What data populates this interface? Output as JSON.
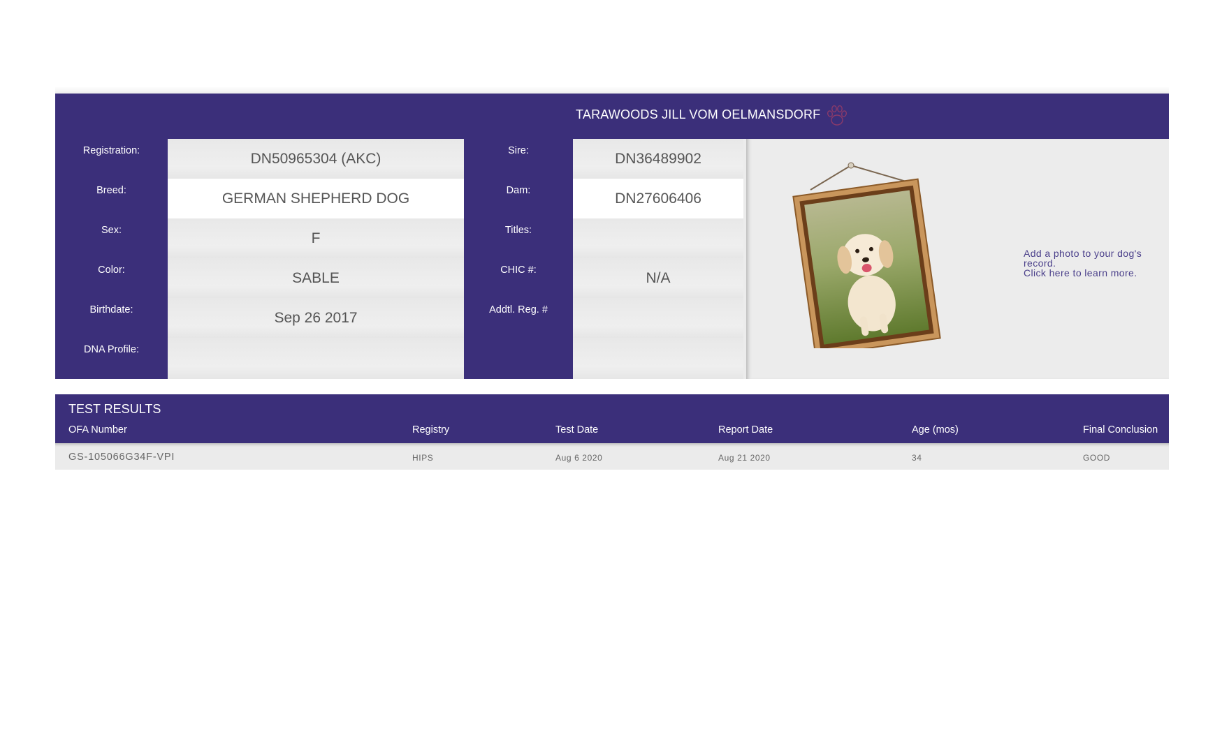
{
  "dog": {
    "name": "TARAWOODS JILL VOM OELMANSDORF"
  },
  "labels_left": {
    "registration": "Registration:",
    "breed": "Breed:",
    "sex": "Sex:",
    "color": "Color:",
    "birthdate": "Birthdate:",
    "dna_profile": "DNA Profile:"
  },
  "values_left": {
    "registration": "DN50965304 (AKC)",
    "breed": "GERMAN SHEPHERD DOG",
    "sex": "F",
    "color": "SABLE",
    "birthdate": "Sep 26 2017",
    "dna_profile": ""
  },
  "labels_right": {
    "sire": "Sire:",
    "dam": "Dam:",
    "titles": "Titles:",
    "chic": "CHIC #:",
    "addtl_reg": "Addtl. Reg. #"
  },
  "values_right": {
    "sire": "DN36489902",
    "dam": "DN27606406",
    "titles": "",
    "chic": "N/A",
    "addtl_reg": ""
  },
  "photo": {
    "link_line1": "Add a photo to your dog's record.",
    "link_line2": "Click here to learn more."
  },
  "results": {
    "title": "TEST RESULTS",
    "columns": [
      "OFA Number",
      "Registry",
      "Test Date",
      "Report Date",
      "Age (mos)",
      "Final Conclusion"
    ],
    "rows": [
      [
        "GS-105066G34F-VPI",
        "HIPS",
        "Aug 6 2020",
        "Aug 21 2020",
        "34",
        "GOOD"
      ]
    ]
  },
  "colors": {
    "brand": "#3b2f7a",
    "panel": "#ececec",
    "value_text": "#555555"
  },
  "icons": [
    "paw-icon"
  ]
}
